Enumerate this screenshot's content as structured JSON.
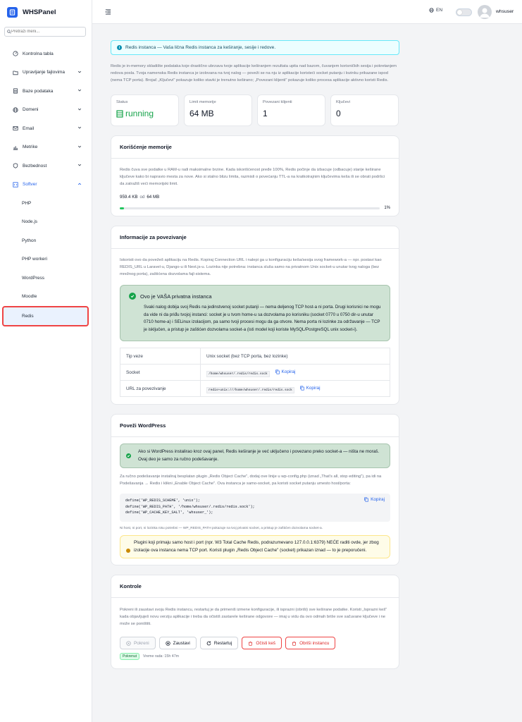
{
  "app": {
    "name": "WHSPanel"
  },
  "sidebar": {
    "search_placeholder": "Pretraži meni...",
    "items": [
      {
        "label": "Kontrolna tabla"
      },
      {
        "label": "Upravljanje fajlovima"
      },
      {
        "label": "Baze podataka"
      },
      {
        "label": "Domeni"
      },
      {
        "label": "Email"
      },
      {
        "label": "Metrike"
      },
      {
        "label": "Bezbednost"
      },
      {
        "label": "Softver"
      }
    ],
    "sub_items": [
      {
        "label": "PHP"
      },
      {
        "label": "Node.js"
      },
      {
        "label": "Python"
      },
      {
        "label": "PHP workeri"
      },
      {
        "label": "WordPress"
      },
      {
        "label": "Moodle"
      },
      {
        "label": "Redis"
      }
    ]
  },
  "topbar": {
    "lang": "EN",
    "username": "whsuser"
  },
  "info_banner": "Redis instanca — Vaša lična Redis instanca za keširanje, sesije i redove.",
  "intro": "Redis je in-memory skladište podataka koje drastično ubrzava tvoje aplikacije keširanjem rezultata upita nad bazom, čuvanjem korisničkih sesija i pokretanjem redova posla. Tvoja namenska Redis instanca je izolovana na tvoj nalog — poveži se na nju iz aplikacije koristeći socket putanju i lozinku prikazane ispod (nema TCP porta). Brojač „Ključevi\" pokazuje koliko stavki je trenutno keširano; „Povezani klijenti\" pokazuje koliko procesa aplikacije aktivno koristi Redis.",
  "stats": [
    {
      "label": "Status",
      "value": "running"
    },
    {
      "label": "Limit memorije",
      "value": "64 MB"
    },
    {
      "label": "Povezani klijenti",
      "value": "1"
    },
    {
      "label": "Ključevi",
      "value": "0"
    }
  ],
  "memory": {
    "title": "Korišćenje memorije",
    "desc": "Redis čuva sve podatke u RAM-u radi maksimalne brzine. Kada iskorišćenost pređe 100%, Redis počinje da izbacuje (odbacuje) starije keširane ključeve kako bi napravio mesta za nove. Ako si stalno blizu limita, razmisli o povećanju TTL-a na kratkotrajnim ključevima keša ili se obrati podršci da zatražiš veći memorijski limit.",
    "used": "959.4 KB",
    "of": "od",
    "limit": "64 MB",
    "percent_label": "1%",
    "percent": 1.5
  },
  "connection": {
    "title": "Informacije za povezivanje",
    "desc": "Iskoristi ovo da povežeš aplikaciju na Redis. Kopiraj Connection URL i nalepi ga u konfiguraciju keša/sesija svog framework-a — npr. postavi kao REDIS_URL u Laravel-u, Django-u ili Next.js-u. Lozinka nije potrebna: instanca sluša samo na privatnom Unix socket-u unutar tvog naloga (bez mrežnog porta), zaštićena dozvolama fajl-sistema.",
    "private_title": "Ovo je VAŠA privatna instanca",
    "private_text": "Svaki nalog dobija svoj Redis na jedinstvenoj socket putanji — nema deljenog TCP host-a ni porta. Drugi korisnici ne mogu da vide ni da priđu tvojoj instanci: socket je u tvom home-u sa dozvolama po korisniku (socket 0770 u 0750 dir-u unutar 0710 home-a) i SELinux izolacijom, pa samo tvoji procesi mogu da ga otvore. Nema porta ni lozinke za održavanje — TCP je isključen, a pristup je zaštićen dozvolama socket-a (isti model koji koriste MySQL/PostgreSQL unix socket-i).",
    "rows": [
      {
        "key": "Tip veze",
        "value": "Unix socket (bez TCP porta, bez lozinke)"
      },
      {
        "key": "Socket",
        "value": "/home/whsuser/.redis/redis.sock"
      },
      {
        "key": "URL za povezivanje",
        "value": "redis+unix:///home/whsuser/.redis/redis.sock"
      }
    ],
    "copy_label": "Kopiraj"
  },
  "wordpress": {
    "title": "Poveži WordPress",
    "notice": "Ako si WordPress instalirao kroz ovaj panel, Redis keširanje je već uključeno i povezano preko socket-a — ništa ne moraš. Ovaj deo je samo za ručno podešavanje.",
    "desc": "Za ručno podešavanje instaliraj besplatan plugin „Redis Object Cache\", dodaj ove linije u wp-config.php (iznad „That's all, stop editing\"), pa idi na Podešavanja → Redis i klikni „Enable Object Cache\". Ova instanca je samo-socket, pa koristi socket putanju umesto host/porta:",
    "code": "define('WP_REDIS_SCHEME', 'unix');\ndefine('WP_REDIS_PATH', '/home/whsuser/.redis/redis.sock');\ndefine('WP_CACHE_KEY_SALT', 'whsuser_');",
    "copy_label": "Kopiraj",
    "note": "Ni host, ni port, ni lozinka nisu potrebni — WP_REDIS_PATH pokazuje na tvoj privatni socket, a pristup je zaštićen dozvolama socket-a.",
    "warning": "Plugini koji primaju samo host i port (npr. W3 Total Cache Redis, podrazumevano 127.0.0.1:6379) NEĆE raditi ovde, jer zbog izolacije ova instanca nema TCP port. Koristi plugin „Redis Object Cache\" (socket) prikazan iznad — to je preporučeni."
  },
  "controls": {
    "title": "Kontrole",
    "desc": "Pokreni ili zaustavi svoju Redis instancu, restartuj je da primeniš izmene konfiguracije, ili isprazni (obriši) sve keširane podatke. Koristi „Isprazni keš\" kada objavljuješ novu verziju aplikacije i treba da očistiš zastarele keširane odgovore — imaj u vidu da ovo odmah briše sve sačuvane ključeve i ne može se poništiti.",
    "start": "Pokreni",
    "stop": "Zaustavi",
    "restart": "Restartuj",
    "flush": "Očisti keš",
    "delete": "Obriši instancu",
    "status_badge": "Pokrenut",
    "uptime": "Vreme rada: 15h 47m"
  },
  "colors": {
    "accent": "#2563eb",
    "success": "#16a34a",
    "danger": "#dc2626",
    "warning": "#ca8a04"
  }
}
